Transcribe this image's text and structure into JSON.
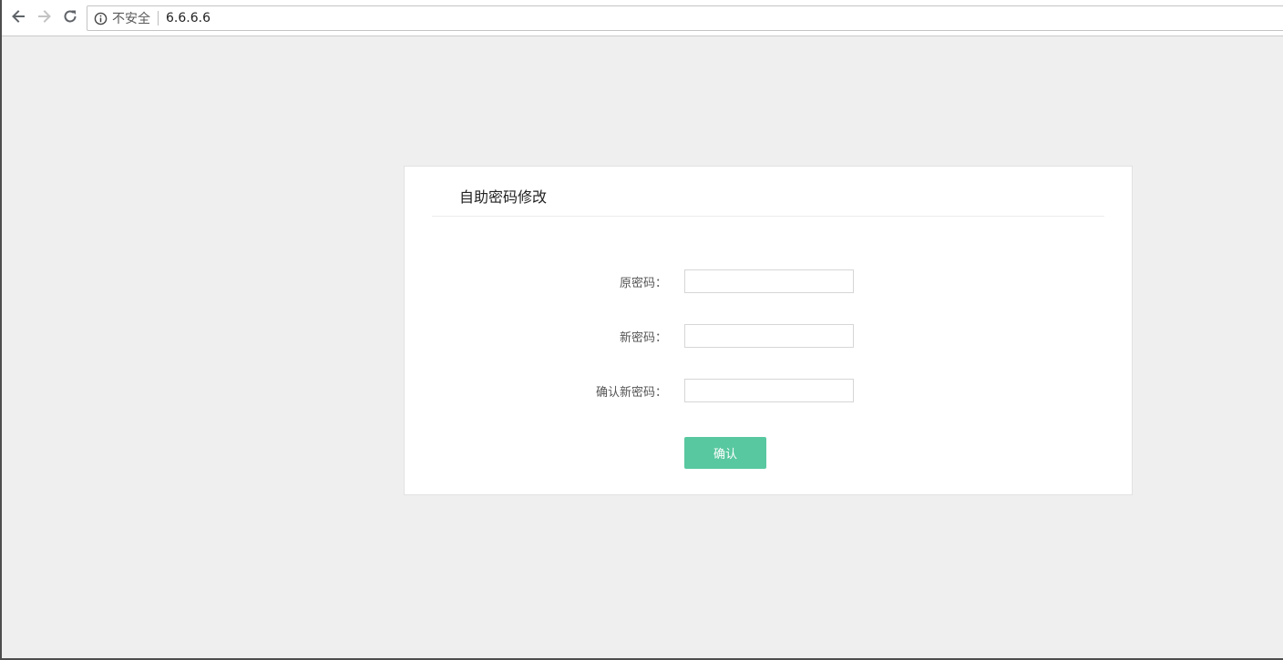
{
  "browser": {
    "security_label": "不安全",
    "url": "6.6.6.6",
    "icons": {
      "back": "arrow-left-icon",
      "forward": "arrow-right-icon",
      "reload": "reload-icon",
      "info": "info-icon"
    }
  },
  "form": {
    "title": "自助密码修改",
    "fields": [
      {
        "label": "原密码：",
        "value": "",
        "placeholder": ""
      },
      {
        "label": "新密码：",
        "value": "",
        "placeholder": ""
      },
      {
        "label": "确认新密码：",
        "value": "",
        "placeholder": ""
      }
    ],
    "submit_label": "确认"
  },
  "colors": {
    "page_background": "#efefef",
    "card_background": "#ffffff",
    "button_background": "#58c8a0",
    "button_text": "#ffffff"
  }
}
